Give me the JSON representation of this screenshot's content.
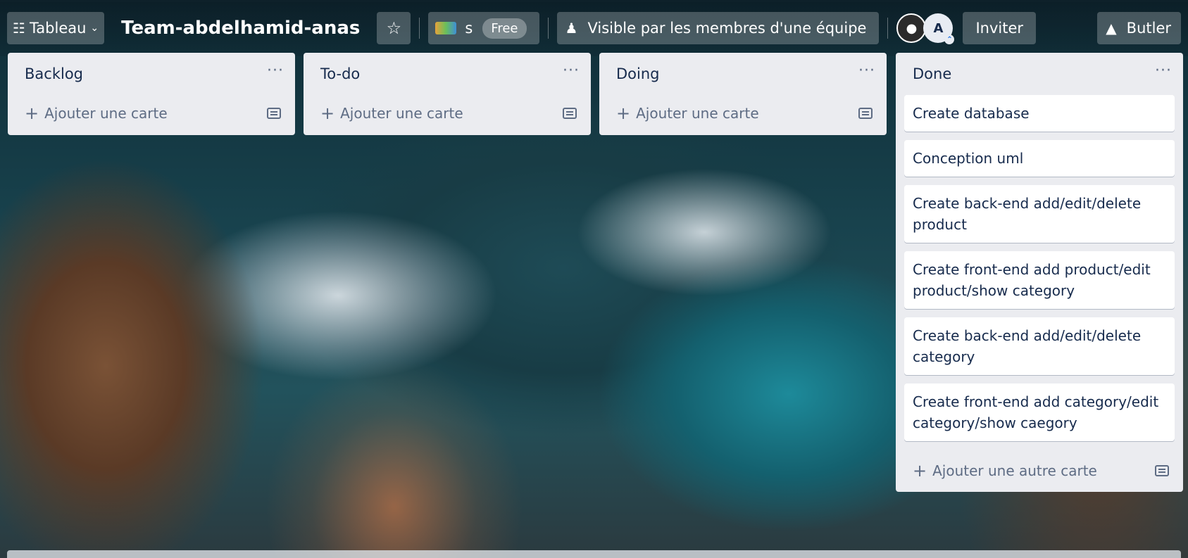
{
  "topbar": {
    "view_label": "Tableau",
    "board_title": "Team-abdelhamid-anas",
    "workspace_name": "s",
    "workspace_plan": "Free",
    "visibility_label": "Visible par les membres d'une équipe",
    "member_initial": "A",
    "invite_label": "Inviter",
    "butler_label": "Butler"
  },
  "lists": [
    {
      "title": "Backlog",
      "menu": "···",
      "cards": [],
      "add_label": "Ajouter une carte"
    },
    {
      "title": "To-do",
      "menu": "···",
      "cards": [],
      "add_label": "Ajouter une carte"
    },
    {
      "title": "Doing",
      "menu": "···",
      "cards": [],
      "add_label": "Ajouter une carte"
    },
    {
      "title": "Done",
      "menu": "···",
      "cards": [
        "Create database",
        "Conception uml",
        "Create back-end add/edit/delete product",
        "Create front-end add product/edit product/show category",
        "Create back-end add/edit/delete category",
        "Create front-end add category/edit category/show caegory"
      ],
      "add_label": "Ajouter une autre carte"
    }
  ],
  "icons": {
    "view": "board-icon",
    "star": "star-icon",
    "visibility": "team-visibility-icon",
    "butler": "butler-bell-icon",
    "add": "plus-icon",
    "template": "card-template-icon"
  }
}
